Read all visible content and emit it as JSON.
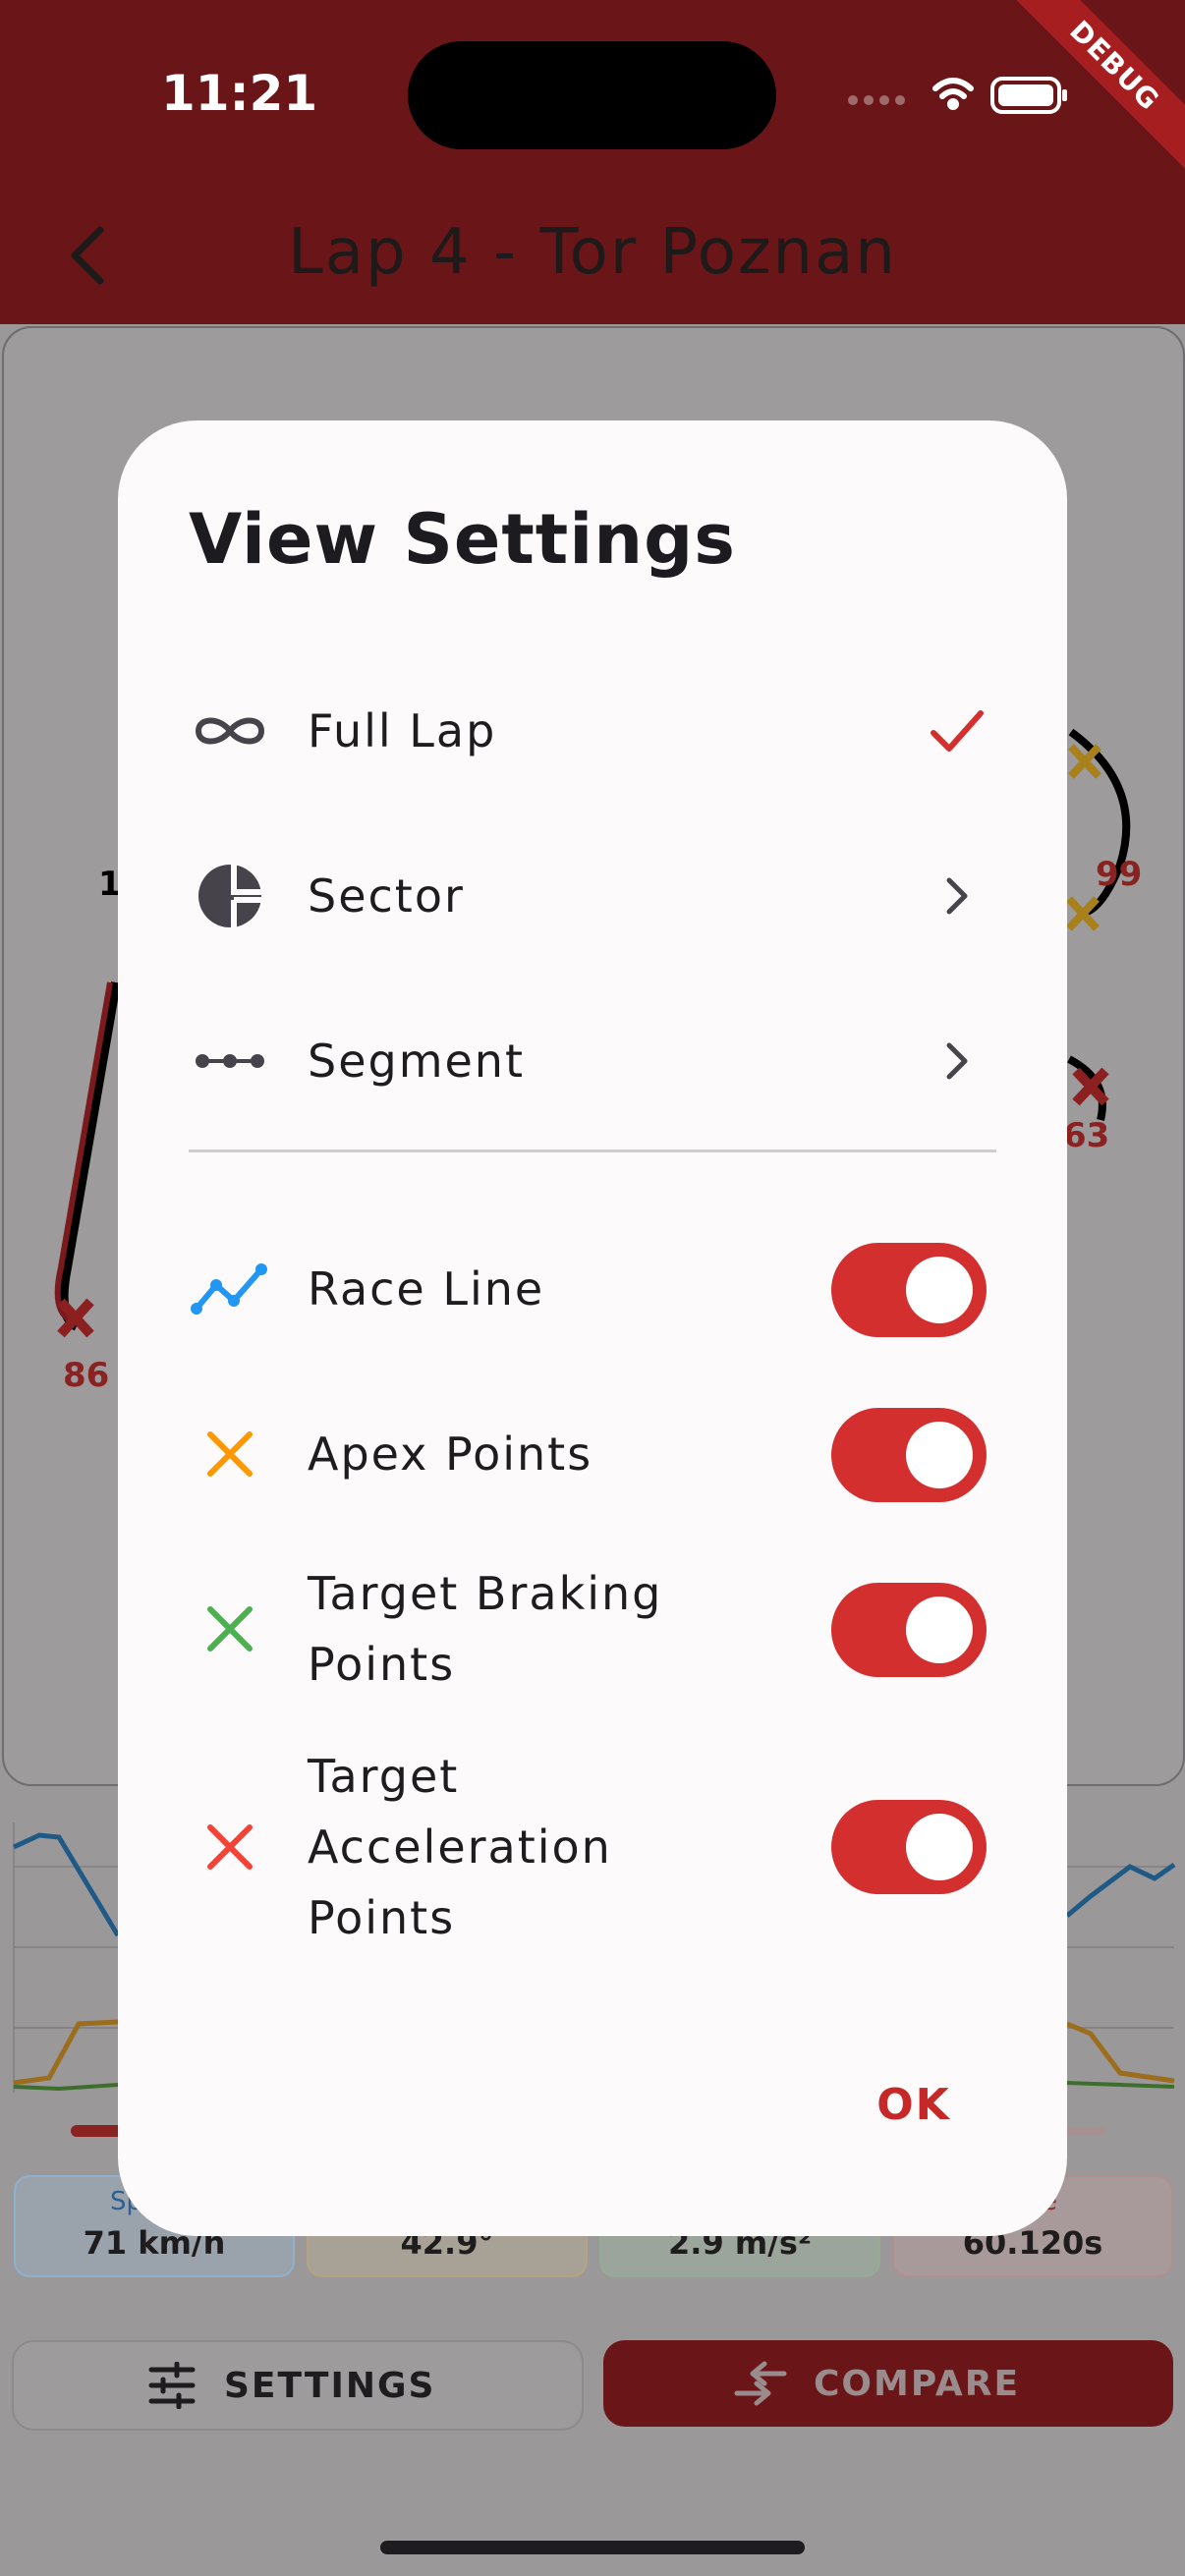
{
  "status_bar": {
    "time": "11:21",
    "debug_label": "DEBUG"
  },
  "app_bar": {
    "title": "Lap 4 - Tor Poznan"
  },
  "map": {
    "labels": [
      {
        "text": "1",
        "color": "#3c7a2c"
      },
      {
        "text": "99",
        "color": "#8a2222"
      },
      {
        "text": "63",
        "color": "#8a2222"
      },
      {
        "text": "86",
        "color": "#8a2222"
      }
    ]
  },
  "stats": [
    {
      "label": "Sp",
      "value": "71 km/h",
      "color": "#8fb0cf"
    },
    {
      "label": "",
      "value": "42.9°",
      "color": "#b6a27f"
    },
    {
      "label": "",
      "value": "2.9 m/s²",
      "color": "#93ad95"
    },
    {
      "label": "e",
      "value": "60.120s",
      "color": "#b08f8f"
    }
  ],
  "bottom_bar": {
    "settings_label": "SETTINGS",
    "compare_label": "COMPARE"
  },
  "dialog": {
    "title": "View Settings",
    "view_modes": [
      {
        "label": "Full Lap",
        "icon": "infinity-icon",
        "selected": true
      },
      {
        "label": "Sector",
        "icon": "sector-pie-icon",
        "selected": false
      },
      {
        "label": "Segment",
        "icon": "segment-dots-icon",
        "selected": false
      }
    ],
    "layers": [
      {
        "label": "Race Line",
        "icon": "race-line-icon",
        "icon_color": "#2196f3",
        "enabled": true
      },
      {
        "label": "Apex Points",
        "icon": "apex-x-icon",
        "icon_color": "#ff9800",
        "enabled": true
      },
      {
        "label": "Target Braking\nPoints",
        "icon": "braking-x-icon",
        "icon_color": "#4caf50",
        "enabled": true
      },
      {
        "label": "Target\nAcceleration\nPoints",
        "icon": "acceleration-x-icon",
        "icon_color": "#f44336",
        "enabled": true
      }
    ],
    "ok_label": "OK",
    "accent_color": "#d32f2f"
  }
}
